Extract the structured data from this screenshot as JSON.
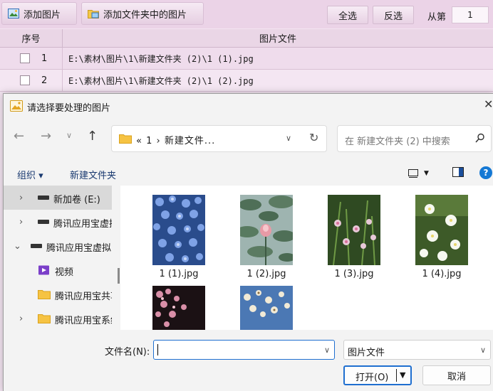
{
  "app": {
    "toolbar": {
      "add_images": "添加图片",
      "add_folder_images": "添加文件夹中的图片",
      "select_all": "全选",
      "invert": "反选",
      "from_label": "从第",
      "from_value": "1"
    },
    "table": {
      "headers": {
        "no": "序号",
        "file": "图片文件"
      },
      "rows": [
        {
          "no": "1",
          "file": "E:\\素材\\图片\\1\\新建文件夹 (2)\\1 (1).jpg"
        },
        {
          "no": "2",
          "file": "E:\\素材\\图片\\1\\新建文件夹 (2)\\1 (2).jpg"
        }
      ]
    },
    "colors": {
      "background": "#f3e4f1",
      "toolbar": "#ebd3e7"
    }
  },
  "dialog": {
    "title": "请选择要处理的图片",
    "nav": {
      "address_crumb": "« 1 › 新建文件...",
      "search_placeholder": "在 新建文件夹 (2) 中搜索"
    },
    "commands": {
      "organize": "组织 ▾",
      "new_folder": "新建文件夹"
    },
    "nav_pane": [
      {
        "label": "新加卷 (E:)",
        "icon": "drive-icon",
        "selected": true
      },
      {
        "label": "腾讯应用宝虚拟",
        "icon": "drive-icon"
      },
      {
        "label": "腾讯应用宝虚拟",
        "icon": "drive-icon",
        "expanded": true
      },
      {
        "label": "视频",
        "icon": "video-library-icon"
      },
      {
        "label": "腾讯应用宝共享",
        "icon": "folder-icon"
      },
      {
        "label": "腾讯应用宝系统",
        "icon": "folder-icon"
      }
    ],
    "files": [
      {
        "name": "1 (1).jpg",
        "icon": "image-thumbnail-blue-flowers"
      },
      {
        "name": "1 (2).jpg",
        "icon": "image-thumbnail-lotus"
      },
      {
        "name": "1 (3).jpg",
        "icon": "image-thumbnail-green-flowers"
      },
      {
        "name": "1 (4).jpg",
        "icon": "image-thumbnail-white-flowers"
      },
      {
        "name": "",
        "icon": "image-thumbnail-pink-blossoms"
      },
      {
        "name": "",
        "icon": "image-thumbnail-white-blossoms"
      }
    ],
    "bottom": {
      "filename_label": "文件名(N):",
      "filename_value": "",
      "filetype": "图片文件",
      "open": "打开(O)",
      "cancel": "取消"
    },
    "colors": {
      "accent": "#1f6fd0",
      "chrome": "#f3f3f3"
    }
  }
}
